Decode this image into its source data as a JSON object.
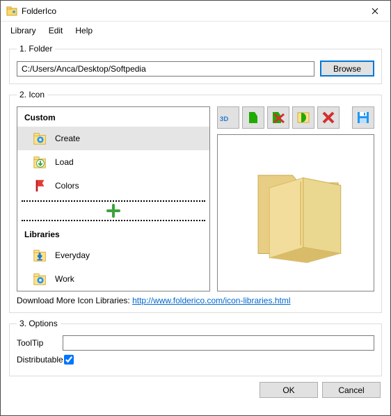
{
  "title": "FolderIco",
  "menu": {
    "library": "Library",
    "edit": "Edit",
    "help": "Help"
  },
  "folder": {
    "legend": "1. Folder",
    "path": "C:/Users/Anca/Desktop/Softpedia",
    "browse": "Browse"
  },
  "icon": {
    "legend": "2. Icon",
    "custom_header": "Custom",
    "custom_items": [
      {
        "label": "Create",
        "icon": "gear-blue"
      },
      {
        "label": "Load",
        "icon": "arrow-down-green"
      },
      {
        "label": "Colors",
        "icon": "flag-red"
      }
    ],
    "libraries_header": "Libraries",
    "library_items": [
      {
        "label": "Everyday",
        "icon": "download-blue"
      },
      {
        "label": "Work",
        "icon": "gear-blue"
      }
    ],
    "download_text": "Download More Icon Libraries: ",
    "download_link": "http://www.folderico.com/icon-libraries.html"
  },
  "options": {
    "legend": "3. Options",
    "tooltip_label": "ToolTip",
    "tooltip_value": "",
    "distributable_label": "Distributable",
    "distributable_checked": true
  },
  "buttons": {
    "ok": "OK",
    "cancel": "Cancel"
  }
}
